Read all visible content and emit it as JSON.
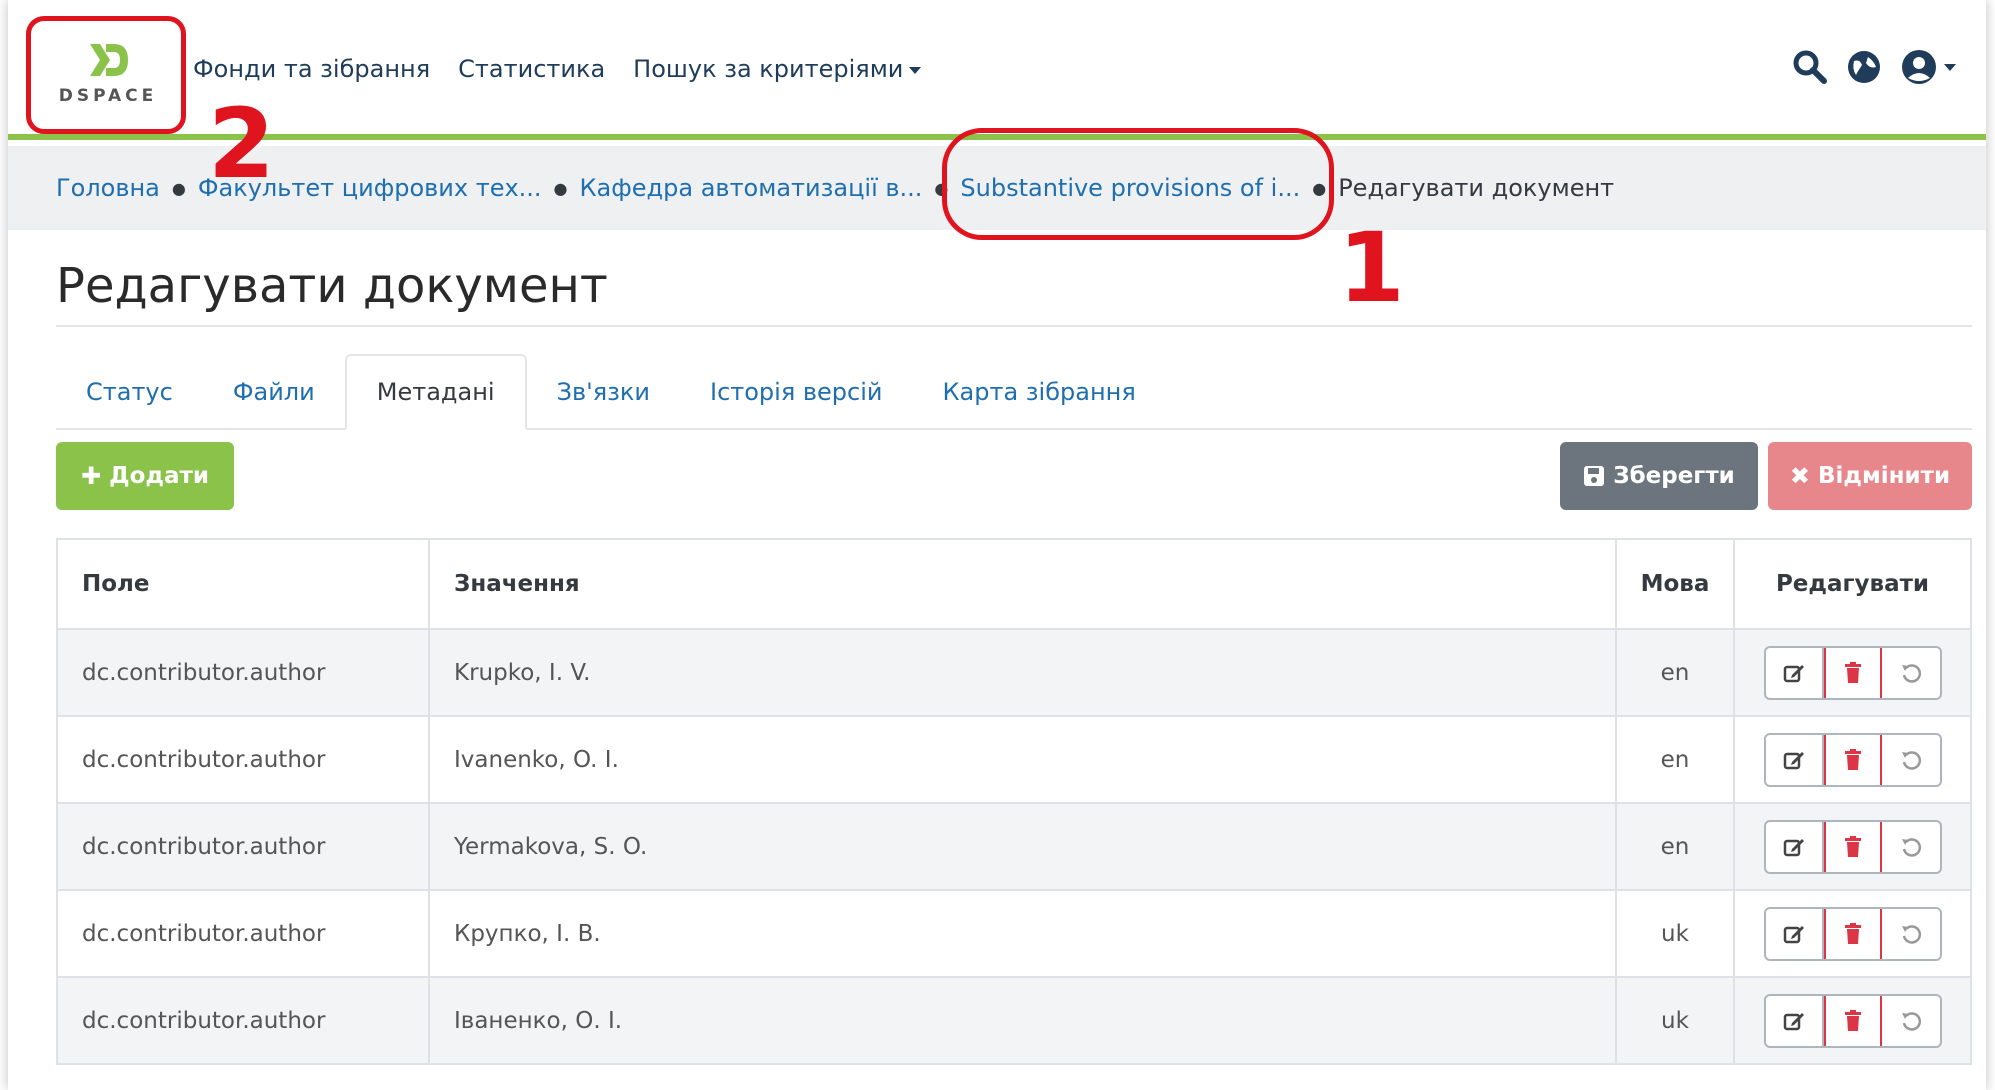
{
  "header": {
    "logo_text": "DSPACE",
    "nav": [
      {
        "label": "Фонди та зібрання"
      },
      {
        "label": "Статистика"
      },
      {
        "label": "Пошук за критеріями"
      }
    ],
    "icons": [
      "search-icon",
      "globe-icon",
      "user-icon"
    ]
  },
  "breadcrumb": [
    {
      "label": "Головна"
    },
    {
      "label": "Факультет цифрових тех..."
    },
    {
      "label": "Кафедра автоматизації в..."
    },
    {
      "label": "Substantive provisions of i..."
    },
    {
      "label": "Редагувати документ"
    }
  ],
  "page_title": "Редагувати документ",
  "tabs": [
    {
      "label": "Статус"
    },
    {
      "label": "Файли"
    },
    {
      "label": "Метадані"
    },
    {
      "label": "Зв'язки"
    },
    {
      "label": "Історія версій"
    },
    {
      "label": "Карта зібрання"
    }
  ],
  "buttons": {
    "add": "Додати",
    "save": "Зберегти",
    "cancel": "Відмінити"
  },
  "table": {
    "headers": [
      "Поле",
      "Значення",
      "Мова",
      "Редагувати"
    ],
    "rows": [
      {
        "field": "dc.contributor.author",
        "value": "Krupko, I. V.",
        "lang": "en"
      },
      {
        "field": "dc.contributor.author",
        "value": "Ivanenko, O. I.",
        "lang": "en"
      },
      {
        "field": "dc.contributor.author",
        "value": "Yermakova, S. O.",
        "lang": "en"
      },
      {
        "field": "dc.contributor.author",
        "value": "Крупко, І. В.",
        "lang": "uk"
      },
      {
        "field": "dc.contributor.author",
        "value": "Іваненко, О. І.",
        "lang": "uk"
      }
    ]
  },
  "annotations": {
    "label1": "1",
    "label2": "2",
    "color": "#e0141e"
  },
  "colors": {
    "accent": "#8bc34a",
    "link": "#1f6fb0",
    "save": "#6c757d",
    "cancel": "#e7868b"
  }
}
